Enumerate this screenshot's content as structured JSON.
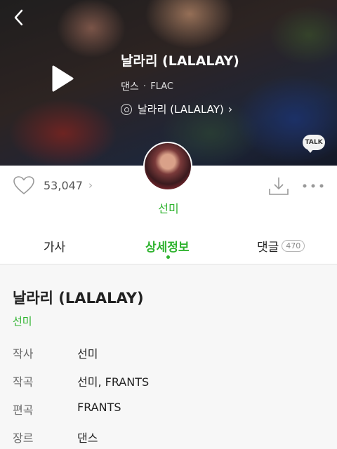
{
  "hero": {
    "song_title": "날라리 (LALALAY)",
    "genre": "댄스",
    "separator": "·",
    "format": "FLAC",
    "album": "날라리 (LALALAY)",
    "album_chevron": "›",
    "talk_label": "TALK"
  },
  "artist": {
    "name": "선미"
  },
  "actions": {
    "like_count": "53,047",
    "like_chevron": "›"
  },
  "tabs": [
    {
      "label": "가사"
    },
    {
      "label": "상세정보",
      "active": true
    },
    {
      "label": "댓글",
      "badge": "470"
    }
  ],
  "detail": {
    "title": "날라리 (LALALAY)",
    "artist": "선미",
    "rows": [
      {
        "key": "작사",
        "value": "선미"
      },
      {
        "key": "작곡",
        "value": "선미, FRANTS"
      },
      {
        "key": "편곡",
        "value": "FRANTS"
      },
      {
        "key": "장르",
        "value": "댄스"
      }
    ]
  },
  "colors": {
    "accent": "#2fb32f"
  },
  "icons": [
    "back-arrow-icon",
    "play-icon",
    "album-disc-icon",
    "kakao-talk-icon",
    "heart-icon",
    "download-icon",
    "more-icon"
  ]
}
